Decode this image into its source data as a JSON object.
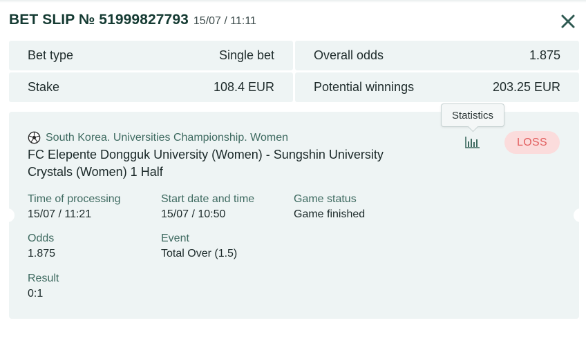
{
  "header": {
    "title": "BET SLIP № 51999827793",
    "date": "15/07 / 11:11"
  },
  "summary": {
    "bet_type_label": "Bet type",
    "bet_type_value": "Single bet",
    "overall_odds_label": "Overall odds",
    "overall_odds_value": "1.875",
    "stake_label": "Stake",
    "stake_value": "108.4 EUR",
    "potential_winnings_label": "Potential winnings",
    "potential_winnings_value": "203.25 EUR"
  },
  "bet": {
    "league": "South Korea. Universities Championship. Women",
    "match": "FC Elepente Dongguk University (Women) - Sungshin University Crystals (Women) 1 Half",
    "status_badge": "LOSS",
    "tooltip": "Statistics",
    "fields": {
      "processing_label": "Time of processing",
      "processing_value": "15/07 / 11:21",
      "start_label": "Start date and time",
      "start_value": "15/07 / 10:50",
      "game_status_label": "Game status",
      "game_status_value": "Game finished",
      "odds_label": "Odds",
      "odds_value": "1.875",
      "event_label": "Event",
      "event_value": "Total Over (1.5)",
      "result_label": "Result",
      "result_value": "0:1"
    }
  },
  "icons": {
    "close": "close-icon",
    "sport": "soccer-ball-icon",
    "statistics": "bar-chart-icon"
  },
  "colors": {
    "accent": "#143a32",
    "label": "#3e6a60",
    "panel": "#eef4f4",
    "loss_bg": "#fbdcdc",
    "loss_text": "#e25f5f",
    "stats_icon": "#3e6a60"
  }
}
